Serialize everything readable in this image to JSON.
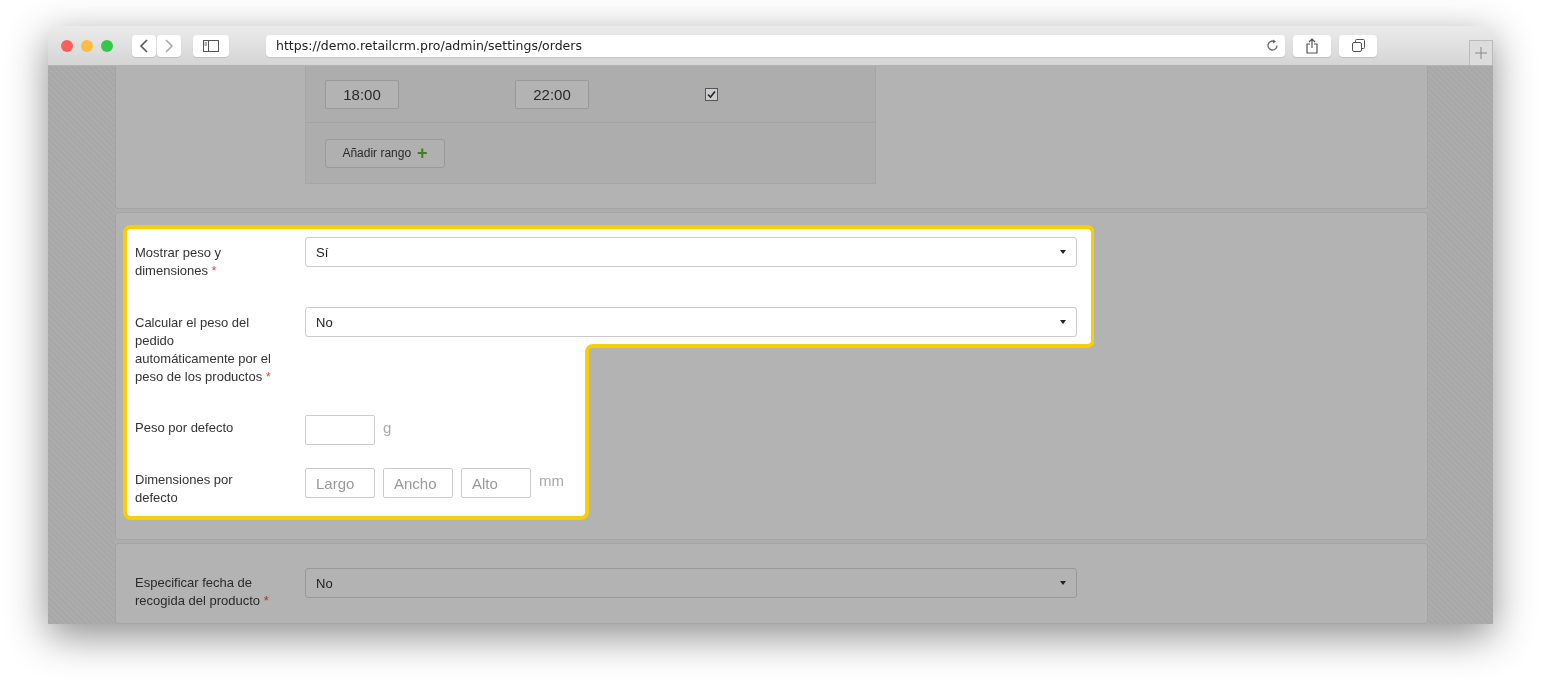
{
  "browser": {
    "url": "https://demo.retailcrm.pro/admin/settings/orders"
  },
  "time_ranges": [
    {
      "from": "18:00",
      "to": "22:00",
      "checked": true
    }
  ],
  "add_range_button": {
    "label": "Añadir rango",
    "icon": "+"
  },
  "weight_section": {
    "highlighted": true,
    "rows": [
      {
        "kind": "select",
        "label": "Mostrar peso y dimensiones",
        "required_mark": "*",
        "value": "Sí"
      },
      {
        "kind": "select",
        "label": "Calcular el peso del pedido automáticamente por el peso de los productos",
        "required_mark": "*",
        "value": "No"
      },
      {
        "kind": "input",
        "label": "Peso por defecto",
        "fields": [
          {
            "kind": "blank"
          }
        ],
        "unit": "g"
      },
      {
        "kind": "input",
        "label": "Dimensiones por defecto",
        "fields": [
          {
            "kind": "hint",
            "placeholder": "Largo"
          },
          {
            "kind": "hint",
            "placeholder": "Ancho"
          },
          {
            "kind": "hint",
            "placeholder": "Alto"
          }
        ],
        "unit": "mm"
      }
    ]
  },
  "pickup_section": {
    "rows": [
      {
        "kind": "select",
        "label": "Especificar fecha de recogida del producto",
        "required_mark": "*",
        "value": "No"
      }
    ]
  }
}
